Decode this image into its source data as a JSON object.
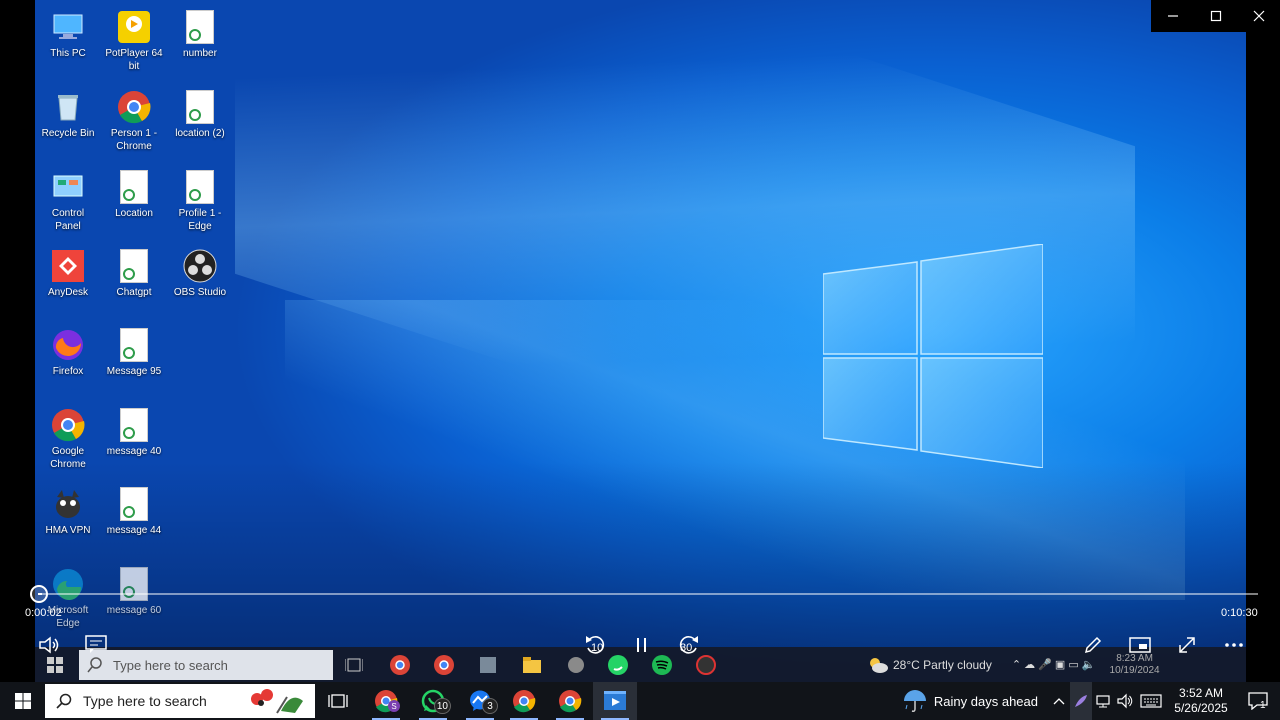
{
  "desktop_icons": [
    {
      "label": "This PC",
      "icon": "this-pc-icon"
    },
    {
      "label": "PotPlayer 64\nbit",
      "icon": "potplayer-icon"
    },
    {
      "label": "number",
      "icon": "document-icon"
    },
    {
      "label": "Recycle Bin",
      "icon": "recycle-bin-icon"
    },
    {
      "label": "Person 1 -\nChrome",
      "icon": "chrome-icon"
    },
    {
      "label": "location (2)",
      "icon": "document-icon"
    },
    {
      "label": "Control\nPanel",
      "icon": "control-panel-icon"
    },
    {
      "label": "Location",
      "icon": "document-icon"
    },
    {
      "label": "Profile 1 -\nEdge",
      "icon": "document-icon"
    },
    {
      "label": "AnyDesk",
      "icon": "anydesk-icon"
    },
    {
      "label": "Chatgpt",
      "icon": "document-icon"
    },
    {
      "label": "OBS Studio",
      "icon": "obs-icon"
    },
    {
      "label": "Firefox",
      "icon": "firefox-icon"
    },
    {
      "label": "Message 95",
      "icon": "document-icon"
    },
    {
      "label": "Google\nChrome",
      "icon": "chrome-icon"
    },
    {
      "label": "message 40",
      "icon": "document-icon"
    },
    {
      "label": "HMA VPN",
      "icon": "hma-vpn-icon"
    },
    {
      "label": "message 44",
      "icon": "document-icon"
    },
    {
      "label": "Microsoft\nEdge",
      "icon": "edge-icon"
    },
    {
      "label": "message 60",
      "icon": "document-icon"
    }
  ],
  "player": {
    "current_time": "0:00:02",
    "duration": "0:10:30",
    "progress_fraction": 0.003,
    "rewind_seconds": "10",
    "forward_seconds": "30"
  },
  "inner_taskbar": {
    "search_placeholder": "Type here to search",
    "weather": "28°C  Partly cloudy",
    "time": "8:23 AM",
    "date": "10/19/2024"
  },
  "taskbar": {
    "search_placeholder": "Type here to search",
    "whatsapp_badge": "10",
    "messenger_badge": "3",
    "weather_text": "Rainy days ahead",
    "time": "3:52 AM",
    "date": "5/26/2025",
    "notification_count": "1"
  },
  "colors": {
    "taskbar_bg": "#111419",
    "desktop_blue": "#0b7ee8",
    "accent": "#8fb8ff"
  }
}
